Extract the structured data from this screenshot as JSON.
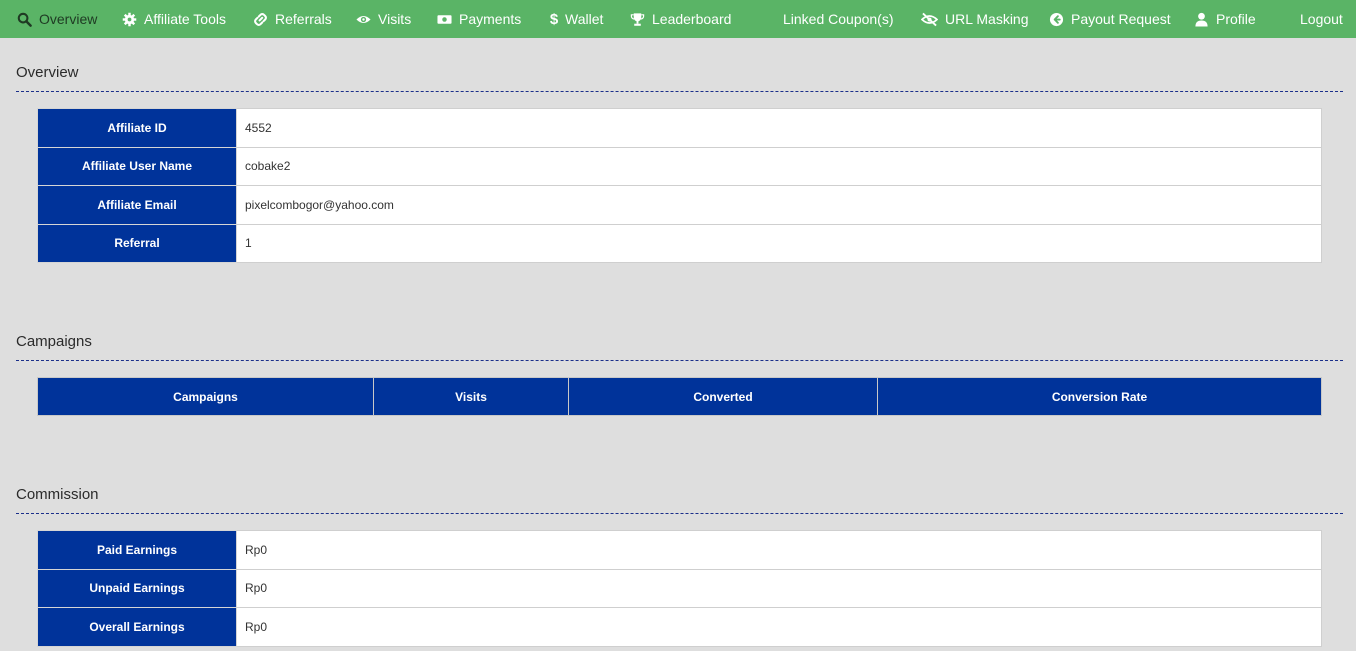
{
  "nav": {
    "overview": "Overview",
    "affiliate_tools": "Affiliate Tools",
    "referrals": "Referrals",
    "visits": "Visits",
    "payments": "Payments",
    "wallet": "Wallet",
    "leaderboard": "Leaderboard",
    "linked_coupons": "Linked Coupon(s)",
    "url_masking": "URL Masking",
    "payout_request": "Payout Request",
    "profile": "Profile",
    "logout": "Logout"
  },
  "icons": {
    "overview": "search-icon",
    "affiliate_tools": "gear-icon",
    "referrals": "link-icon",
    "visits": "eye-icon",
    "payments": "money-bill-icon",
    "wallet": "dollar-icon",
    "leaderboard": "trophy-icon",
    "url_masking": "eye-slash-icon",
    "payout_request": "arrow-circle-left-icon",
    "profile": "user-icon"
  },
  "colors": {
    "nav_bg": "#5ab466",
    "header_cell_bg": "#00339a",
    "page_bg": "#dedede"
  },
  "overview": {
    "title": "Overview",
    "rows": [
      {
        "label": "Affiliate ID",
        "value": "4552"
      },
      {
        "label": "Affiliate User Name",
        "value": "cobake2"
      },
      {
        "label": "Affiliate Email",
        "value": "pixelcombogor@yahoo.com"
      },
      {
        "label": "Referral",
        "value": "1"
      }
    ]
  },
  "campaigns": {
    "title": "Campaigns",
    "columns": [
      "Campaigns",
      "Visits",
      "Converted",
      "Conversion Rate"
    ]
  },
  "commission": {
    "title": "Commission",
    "rows": [
      {
        "label": "Paid Earnings",
        "value": "Rp0"
      },
      {
        "label": "Unpaid Earnings",
        "value": "Rp0"
      },
      {
        "label": "Overall Earnings",
        "value": "Rp0"
      }
    ]
  }
}
